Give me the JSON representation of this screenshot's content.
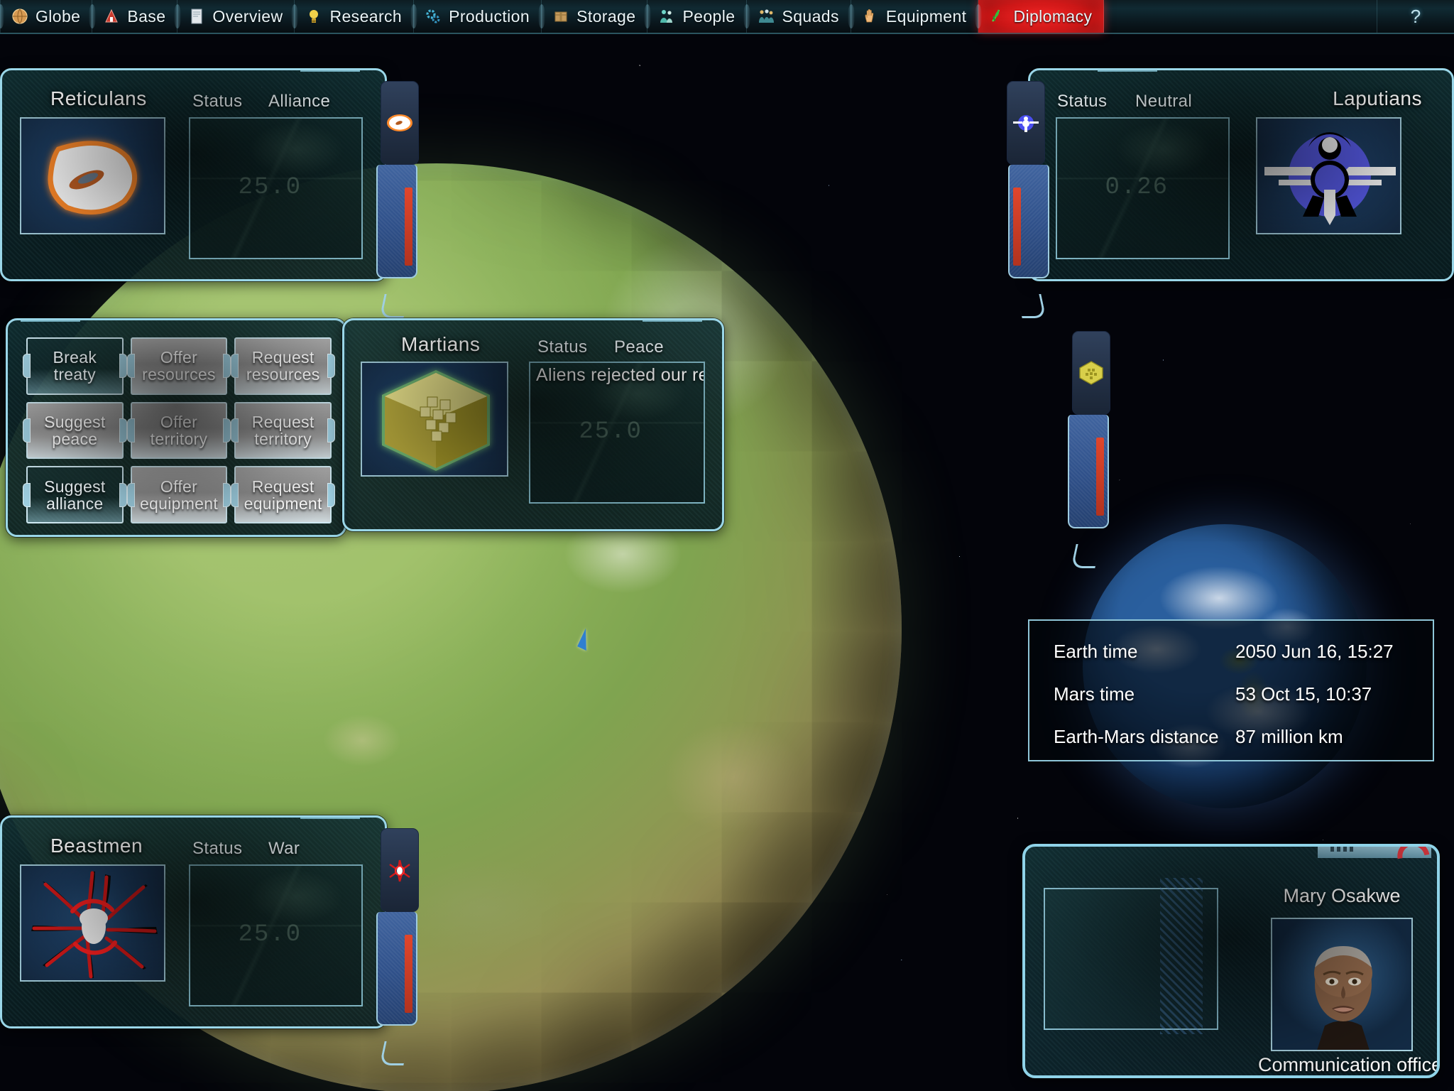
{
  "nav": {
    "tabs": [
      {
        "label": "Globe",
        "icon": "globe-icon",
        "glyph": "🌐",
        "active": false
      },
      {
        "label": "Base",
        "icon": "base-icon",
        "glyph": "🏠",
        "active": false
      },
      {
        "label": "Overview",
        "icon": "overview-icon",
        "glyph": "📄",
        "active": false
      },
      {
        "label": "Research",
        "icon": "research-icon",
        "glyph": "💡",
        "active": false
      },
      {
        "label": "Production",
        "icon": "production-icon",
        "glyph": "⚙",
        "active": false
      },
      {
        "label": "Storage",
        "icon": "storage-icon",
        "glyph": "📦",
        "active": false
      },
      {
        "label": "People",
        "icon": "people-icon",
        "glyph": "👥",
        "active": false
      },
      {
        "label": "Squads",
        "icon": "squads-icon",
        "glyph": "👪",
        "active": false
      },
      {
        "label": "Equipment",
        "icon": "equipment-icon",
        "glyph": "✋",
        "active": false
      },
      {
        "label": "Diplomacy",
        "icon": "diplomacy-icon",
        "glyph": "🌿",
        "active": true
      }
    ],
    "help_label": "?",
    "active_accent": "#ff2a2a"
  },
  "factions": {
    "reticulans": {
      "name": "Reticulans",
      "status_label": "Status",
      "status_value": "Alliance",
      "emblem": "reticulan-eye-emblem",
      "emblem_color": "#ffffff",
      "ghost_value": "25.0"
    },
    "laputians": {
      "name": "Laputians",
      "status_label": "Status",
      "status_value": "Neutral",
      "emblem": "laputian-winged-orb-emblem",
      "emblem_color": "#5a5ef0",
      "ghost_value": "0.26"
    },
    "martians": {
      "name": "Martians",
      "status_label": "Status",
      "status_value": "Peace",
      "emblem": "martian-hex-emblem",
      "emblem_color": "#d8cf4a",
      "message": "Aliens rejected our request",
      "ghost_value": "25.0"
    },
    "beastmen": {
      "name": "Beastmen",
      "status_label": "Status",
      "status_value": "War",
      "emblem": "beastmen-claw-emblem",
      "emblem_color": "#d01a1a",
      "ghost_value": "25.0"
    }
  },
  "diplomacy_actions": [
    {
      "label": "Break\ntreaty",
      "line1": "Break",
      "line2": "treaty",
      "enabled": false
    },
    {
      "label": "Offer resources",
      "line1": "Offer",
      "line2": "resources",
      "enabled": true
    },
    {
      "label": "Request resources",
      "line1": "Request",
      "line2": "resources",
      "enabled": true
    },
    {
      "label": "Suggest peace",
      "line1": "Suggest",
      "line2": "peace",
      "enabled": true
    },
    {
      "label": "Offer territory",
      "line1": "Offer",
      "line2": "territory",
      "enabled": true
    },
    {
      "label": "Request territory",
      "line1": "Request",
      "line2": "territory",
      "enabled": true
    },
    {
      "label": "Suggest alliance",
      "line1": "Suggest",
      "line2": "alliance",
      "enabled": false
    },
    {
      "label": "Offer equipment",
      "line1": "Offer",
      "line2": "equipment",
      "enabled": true
    },
    {
      "label": "Request equipment",
      "line1": "Request",
      "line2": "equipment",
      "enabled": true
    }
  ],
  "info": {
    "rows": [
      {
        "label": "Earth time",
        "value": "2050 Jun 16, 15:27"
      },
      {
        "label": "Mars time",
        "value": "53 Oct 15, 10:37"
      },
      {
        "label": "Earth-Mars distance",
        "value": "87 million km"
      }
    ]
  },
  "officer": {
    "name": "Mary Osakwe",
    "role": "Communication officer"
  }
}
